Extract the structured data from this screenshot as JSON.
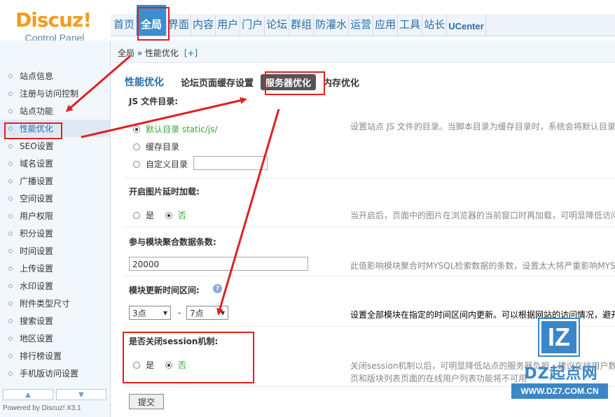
{
  "logo": {
    "main": "Discuz!",
    "sub": "Control Panel"
  },
  "topnav": [
    {
      "label": "首页",
      "active": false
    },
    {
      "label": "全局",
      "active": true
    },
    {
      "label": "界面",
      "active": false
    },
    {
      "label": "内容",
      "active": false
    },
    {
      "label": "用户",
      "active": false
    },
    {
      "label": "门户",
      "active": false
    },
    {
      "label": "论坛",
      "active": false
    },
    {
      "label": "群组",
      "active": false
    },
    {
      "label": "防灌水",
      "active": false
    },
    {
      "label": "运营",
      "active": false
    },
    {
      "label": "应用",
      "active": false
    },
    {
      "label": "工具",
      "active": false
    },
    {
      "label": "站长",
      "active": false
    },
    {
      "label": "UCenter",
      "active": false
    }
  ],
  "breadcrumb": {
    "text": "全局 » 性能优化",
    "plus": "[+]"
  },
  "sidebar": {
    "items": [
      {
        "label": "站点信息"
      },
      {
        "label": "注册与访问控制"
      },
      {
        "label": "站点功能"
      },
      {
        "label": "性能优化",
        "active": true
      },
      {
        "label": "SEO设置"
      },
      {
        "label": "域名设置"
      },
      {
        "label": "广播设置"
      },
      {
        "label": "空间设置"
      },
      {
        "label": "用户权限"
      },
      {
        "label": "积分设置"
      },
      {
        "label": "时间设置"
      },
      {
        "label": "上传设置"
      },
      {
        "label": "水印设置"
      },
      {
        "label": "附件类型尺寸"
      },
      {
        "label": "搜索设置"
      },
      {
        "label": "地区设置"
      },
      {
        "label": "排行榜设置"
      },
      {
        "label": "手机版访问设置"
      }
    ],
    "up": "▲",
    "down": "▼",
    "powered": "Powered by Discuz! X3.1"
  },
  "main": {
    "title": "性能优化",
    "subtabs": [
      "论坛页面缓存设置",
      "服务器优化",
      "内存优化"
    ],
    "active_subtab": "服务器优化",
    "js_dir": {
      "title": "JS 文件目录:",
      "opt1": "默认目录 static/js/",
      "opt2": "缓存目录",
      "opt3": "自定义目录",
      "custom_value": "",
      "desc": "设置站点 JS 文件的目录。当脚本目录为缓存目录时，系统会将默认目录"
    },
    "lazyload": {
      "title": "开启图片延时加载:",
      "yes": "是",
      "no": "否",
      "desc": "当开启后，页面中的图片在浏览器的当前窗口时再加载，可明显降低访问"
    },
    "block_max": {
      "title": "参与模块聚合数据条数:",
      "value": "20000",
      "desc": "此值影响模块聚合时MYSQL检索数据的条数，设置太大将严重影响MYS"
    },
    "block_time": {
      "title": "模块更新时间区间:",
      "help": "?",
      "from": "3点",
      "dash": "-",
      "to": "7点",
      "desc": "设置全部模块在指定的时间区间内更新。可以根据网站的访问情况，避开"
    },
    "session": {
      "title": "是否关闭session机制:",
      "yes": "是",
      "no": "否",
      "desc1": "关闭session机制以后，可明显降低站点的服务器负担，建议在线用户数",
      "desc2": "页和版块列表页面的在线用户列表功能将不可用"
    },
    "submit": "提交"
  },
  "watermark": {
    "box": "IZ",
    "text": "DZ起点网",
    "url": "WWW.DZ7.COM.CN"
  },
  "colors": {
    "accent": "#276ca8",
    "annotation": "#e02020",
    "active_tab": "#3b8fcf"
  }
}
